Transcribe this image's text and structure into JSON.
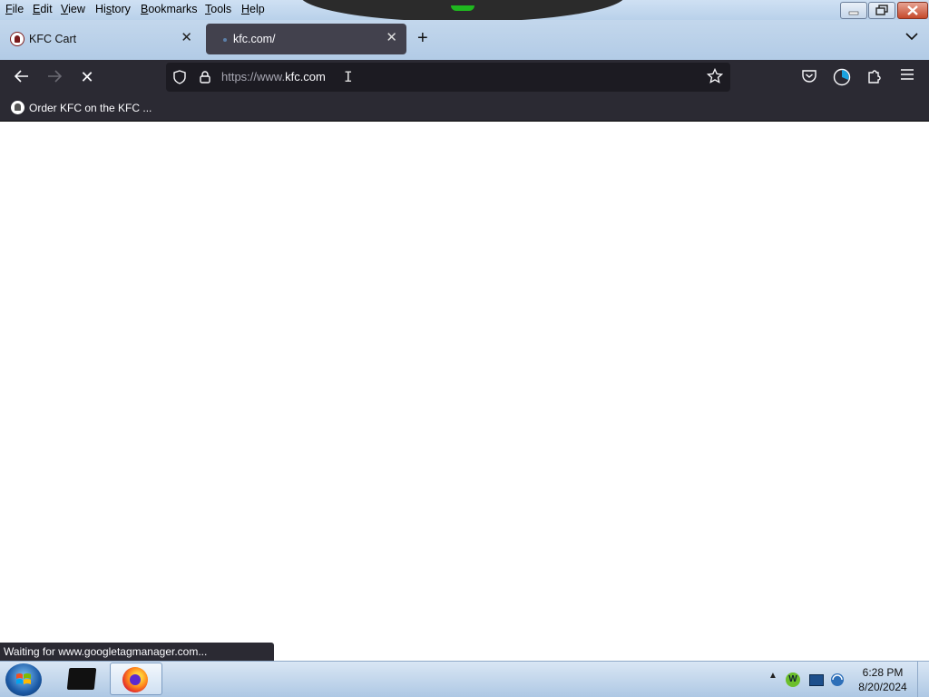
{
  "menubar": {
    "items": [
      "File",
      "Edit",
      "View",
      "History",
      "Bookmarks",
      "Tools",
      "Help"
    ],
    "mnemonics": [
      "F",
      "E",
      "V",
      "s",
      "B",
      "T",
      "H"
    ]
  },
  "tabs": [
    {
      "title": "KFC Cart",
      "active": false
    },
    {
      "title": "kfc.com/",
      "active": true
    }
  ],
  "navbar": {
    "url_prefix": "https://www.",
    "url_domain": "kfc.com",
    "stop_glyph": "✕"
  },
  "bookmarks": [
    {
      "label": "Order KFC on the KFC ..."
    }
  ],
  "status": {
    "text": "Waiting for www.googletagmanager.com..."
  },
  "taskbar": {
    "clock_time": "6:28 PM",
    "clock_date": "8/20/2024",
    "tray_badge": "W"
  },
  "colors": {
    "toolbar_bg": "#2b2a33",
    "urlbar_bg": "#1c1b22",
    "active_tab_bg": "#42414d"
  }
}
